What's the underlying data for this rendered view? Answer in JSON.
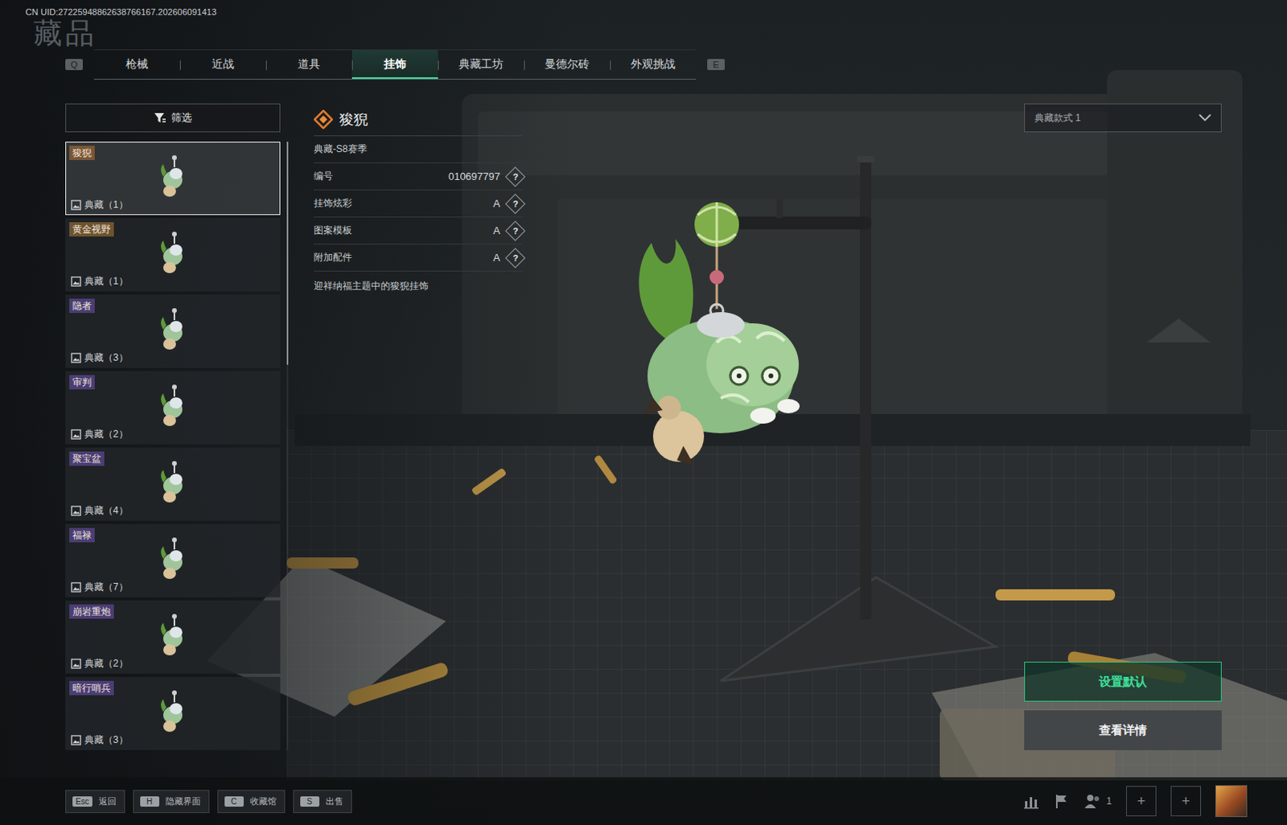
{
  "header": {
    "uid": "CN UID:27225948862638766167.202606091413",
    "title": "藏品"
  },
  "tabs": {
    "prev_key": "Q",
    "next_key": "E",
    "items": [
      {
        "label": "枪械",
        "selected": false
      },
      {
        "label": "近战",
        "selected": false
      },
      {
        "label": "道具",
        "selected": false
      },
      {
        "label": "挂饰",
        "selected": true
      },
      {
        "label": "典藏工坊",
        "selected": false
      },
      {
        "label": "曼德尔砖",
        "selected": false
      },
      {
        "label": "外观挑战",
        "selected": false
      }
    ]
  },
  "filter": {
    "label": "筛选"
  },
  "list": {
    "items": [
      {
        "name": "狻猊",
        "count": "典藏（1）",
        "color": "#7a5634",
        "selected": true
      },
      {
        "name": "黄金视野",
        "count": "典藏（1）",
        "color": "#6e5330",
        "selected": false
      },
      {
        "name": "隐者",
        "count": "典藏（3）",
        "color": "#4b3d74",
        "selected": false
      },
      {
        "name": "审判",
        "count": "典藏（2）",
        "color": "#4b3d74",
        "selected": false
      },
      {
        "name": "聚宝盆",
        "count": "典藏（4）",
        "color": "#4b3d74",
        "selected": false
      },
      {
        "name": "福禄",
        "count": "典藏（7）",
        "color": "#4b3d74",
        "selected": false
      },
      {
        "name": "崩岩重炮",
        "count": "典藏（2）",
        "color": "#4b3d74",
        "selected": false
      },
      {
        "name": "暗行哨兵",
        "count": "典藏（3）",
        "color": "#4b3d74",
        "selected": false
      }
    ]
  },
  "detail": {
    "name": "狻猊",
    "season": "典藏-S8赛季",
    "rows": [
      {
        "label": "编号",
        "value": "010697797",
        "help": "?"
      },
      {
        "label": "挂饰炫彩",
        "value": "A",
        "help": "?"
      },
      {
        "label": "图案模板",
        "value": "A",
        "help": "?"
      },
      {
        "label": "附加配件",
        "value": "A",
        "help": "?"
      }
    ],
    "description": "迎祥纳福主题中的狻猊挂饰"
  },
  "style_select": {
    "value": "典藏款式 1"
  },
  "actions": [
    {
      "label": "设置默认",
      "primary": true
    },
    {
      "label": "查看详情",
      "primary": false
    }
  ],
  "bottom_bar": {
    "keys": [
      {
        "key": "Esc",
        "label": "返回"
      },
      {
        "key": "H",
        "label": "隐藏界面"
      },
      {
        "key": "C",
        "label": "收藏馆"
      },
      {
        "key": "S",
        "label": "出售"
      }
    ],
    "squad_count": "1",
    "slots": [
      "+",
      "+"
    ]
  }
}
